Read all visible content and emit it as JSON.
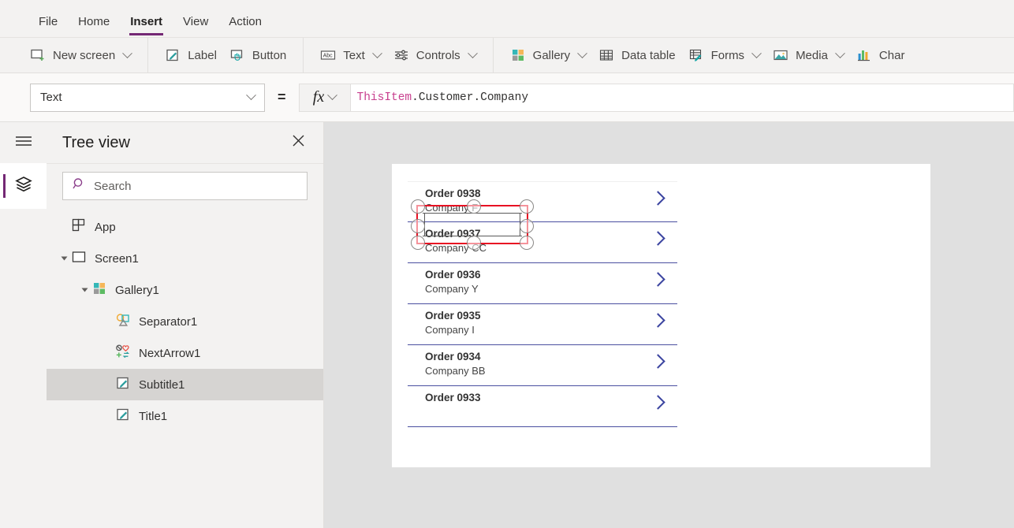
{
  "menu": {
    "items": [
      {
        "label": "File",
        "active": false
      },
      {
        "label": "Home",
        "active": false
      },
      {
        "label": "Insert",
        "active": true
      },
      {
        "label": "View",
        "active": false
      },
      {
        "label": "Action",
        "active": false
      }
    ],
    "accent_color": "#742774"
  },
  "ribbon": {
    "groups": [
      {
        "buttons": [
          {
            "label": "New screen",
            "icon": "new-screen-icon",
            "caret": true
          }
        ]
      },
      {
        "buttons": [
          {
            "label": "Label",
            "icon": "label-icon",
            "caret": false
          },
          {
            "label": "Button",
            "icon": "button-icon",
            "caret": false
          }
        ]
      },
      {
        "buttons": [
          {
            "label": "Text",
            "icon": "text-abc-icon",
            "caret": true
          },
          {
            "label": "Controls",
            "icon": "controls-sliders-icon",
            "caret": true
          }
        ]
      },
      {
        "buttons": [
          {
            "label": "Gallery",
            "icon": "gallery-icon",
            "caret": true
          },
          {
            "label": "Data table",
            "icon": "data-table-icon",
            "caret": false
          },
          {
            "label": "Forms",
            "icon": "forms-icon",
            "caret": true
          },
          {
            "label": "Media",
            "icon": "media-icon",
            "caret": true
          },
          {
            "label": "Char",
            "icon": "charts-icon",
            "caret": false
          }
        ]
      }
    ]
  },
  "formula_bar": {
    "property_value": "Text",
    "equals": "=",
    "fx_label": "fx",
    "formula_object": "ThisItem",
    "formula_rest": ".Customer.Company",
    "formula_full": "ThisItem.Customer.Company",
    "object_token_color": "#c83f8e"
  },
  "rail": {
    "hamburger_icon": "hamburger-icon",
    "tabs": [
      {
        "icon": "layers-icon",
        "active": true
      }
    ]
  },
  "tree_view": {
    "title": "Tree view",
    "close_icon": "close-icon",
    "search": {
      "placeholder": "Search",
      "value": "",
      "icon": "search-icon"
    },
    "items": [
      {
        "label": "App",
        "icon": "app-icon",
        "indent": 0,
        "twisty": "none",
        "selected": false
      },
      {
        "label": "Screen1",
        "icon": "screen-icon",
        "indent": 0,
        "twisty": "open",
        "selected": false
      },
      {
        "label": "Gallery1",
        "icon": "gallery-icon",
        "indent": 1,
        "twisty": "open",
        "selected": false
      },
      {
        "label": "Separator1",
        "icon": "separator-icon",
        "indent": 2,
        "twisty": "none",
        "selected": false
      },
      {
        "label": "NextArrow1",
        "icon": "next-arrow-icon",
        "indent": 2,
        "twisty": "none",
        "selected": false
      },
      {
        "label": "Subtitle1",
        "icon": "label-icon",
        "indent": 2,
        "twisty": "none",
        "selected": true
      },
      {
        "label": "Title1",
        "icon": "label-icon",
        "indent": 2,
        "twisty": "none",
        "selected": false
      }
    ]
  },
  "canvas": {
    "gallery_rows": [
      {
        "title": "Order 0938",
        "subtitle": "Company F",
        "selected": true
      },
      {
        "title": "Order 0937",
        "subtitle": "Company CC",
        "selected": false
      },
      {
        "title": "Order 0936",
        "subtitle": "Company Y",
        "selected": false
      },
      {
        "title": "Order 0935",
        "subtitle": "Company I",
        "selected": false
      },
      {
        "title": "Order 0934",
        "subtitle": "Company BB",
        "selected": false
      },
      {
        "title": "Order 0933",
        "subtitle": "",
        "selected": false
      }
    ],
    "selection_border_color": "#e81123",
    "chevron_color": "#3b44a0",
    "separator_color": "#4a4fa0"
  }
}
